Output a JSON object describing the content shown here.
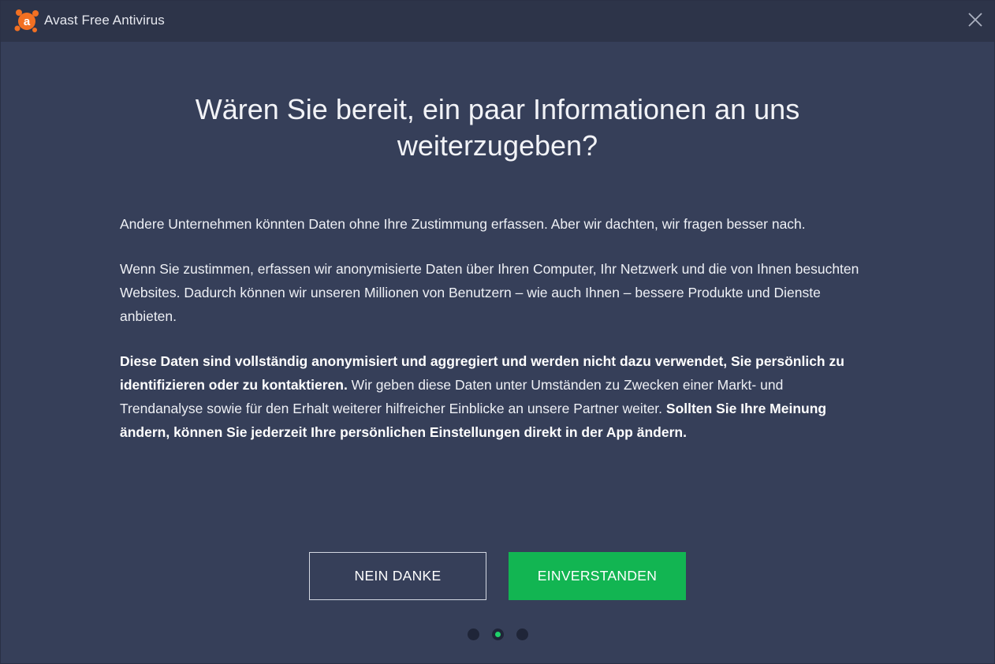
{
  "window": {
    "title": "Avast Free Antivirus",
    "logo_icon": "avast-logo-icon",
    "close_icon": "close-icon",
    "brand_color": "#f27022"
  },
  "main": {
    "headline": "Wären Sie bereit, ein paar Informationen an uns weiterzugeben?",
    "paragraph1": "Andere Unternehmen könnten Daten ohne Ihre Zustimmung erfassen. Aber wir dachten, wir fragen besser nach.",
    "paragraph2": "Wenn Sie zustimmen, erfassen wir anonymisierte Daten über Ihren Computer, Ihr Netzwerk und die von Ihnen besuchten Websites. Dadurch können wir unseren Millionen von Benutzern – wie auch Ihnen – bessere Produkte und Dienste anbieten.",
    "paragraph3": {
      "bold1": "Diese Daten sind vollständig anonymisiert und aggregiert und werden nicht dazu verwendet, Sie persönlich zu identifizieren oder zu kontaktieren.",
      "normal": " Wir geben diese Daten unter Umständen zu Zwecken einer Markt- und Trendanalyse sowie für den Erhalt weiterer hilfreicher Einblicke an unsere Partner weiter. ",
      "bold2": "Sollten Sie Ihre Meinung ändern, können Sie jederzeit Ihre persönlichen Einstellungen direkt in der App ändern."
    }
  },
  "buttons": {
    "decline_label": "NEIN DANKE",
    "accept_label": "EINVERSTANDEN",
    "accept_color": "#12b552"
  },
  "pagination": {
    "total": 3,
    "active_index": 1,
    "active_color": "#1fd16a"
  }
}
